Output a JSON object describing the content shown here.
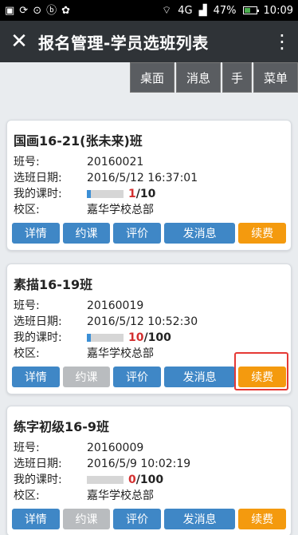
{
  "status_bar": {
    "time": "10:09",
    "battery": "47%",
    "network": "4G"
  },
  "app_bar": {
    "title": "报名管理-学员选班列表",
    "close_icon": "close-icon",
    "more_icon": "more-vert-icon"
  },
  "toolbar": {
    "items": [
      {
        "label": "桌面"
      },
      {
        "label": "消息"
      },
      {
        "label": "手"
      },
      {
        "label": "菜单"
      }
    ]
  },
  "labels": {
    "class_no": "班号:",
    "select_date": "选班日期:",
    "my_hours": "我的课时:",
    "campus": "校区:"
  },
  "actions": {
    "detail": "详情",
    "book": "约课",
    "review": "评价",
    "message": "发消息",
    "renew": "续费"
  },
  "colors": {
    "accent_blue": "#3f87c6",
    "renew_orange": "#f49a0e",
    "disabled_gray": "#b9bcbf",
    "highlight_red": "#e53935"
  },
  "classes": [
    {
      "title": "国画16-21(张未来)班",
      "class_no": "20160021",
      "select_date": "2016/5/12 16:37:01",
      "hours_used": "1",
      "hours_total": "/10",
      "progress": 0.1,
      "campus": "嘉华学校总部",
      "book_enabled": true
    },
    {
      "title": "素描16-19班",
      "class_no": "20160019",
      "select_date": "2016/5/12 10:52:30",
      "hours_used": "10",
      "hours_total": "/100",
      "progress": 0.1,
      "campus": "嘉华学校总部",
      "book_enabled": false
    },
    {
      "title": "练字初级16-9班",
      "class_no": "20160009",
      "select_date": "2016/5/9 10:02:19",
      "hours_used": "0",
      "hours_total": "/100",
      "progress": 0.0,
      "campus": "嘉华学校总部",
      "book_enabled": false
    }
  ]
}
